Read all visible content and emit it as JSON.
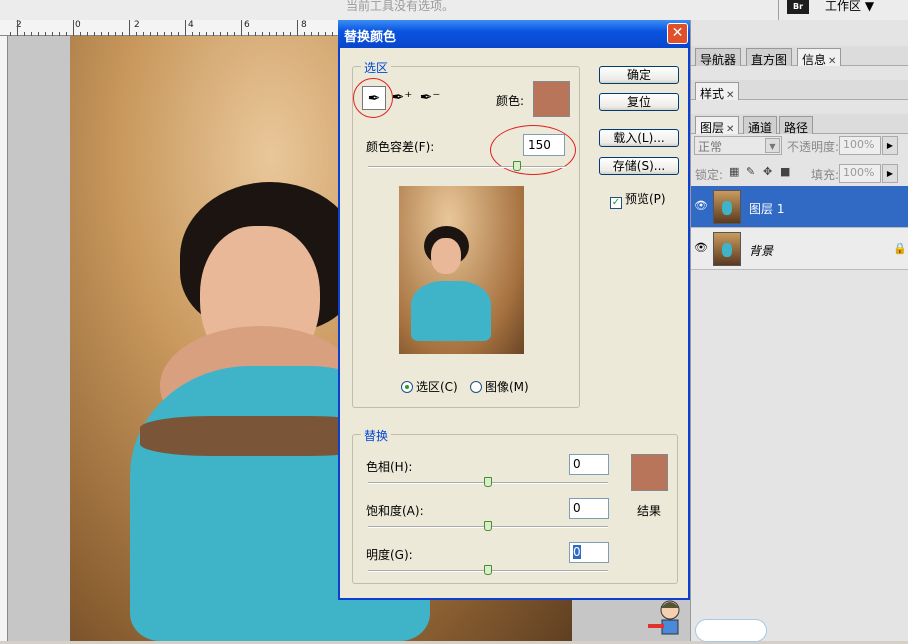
{
  "options_bar": {
    "text": "当前工具没有选项。",
    "workspace": "工作区",
    "br_label": "Br"
  },
  "ruler": {
    "labels": [
      "2",
      "0",
      "2",
      "4",
      "6",
      "8"
    ]
  },
  "panels": {
    "row1_tabs": [
      "导航器",
      "直方图",
      "信息"
    ],
    "row2_tabs": [
      "样式"
    ],
    "row3_tabs": [
      "图层",
      "通道",
      "路径"
    ],
    "blend_mode": "正常",
    "opacity_label": "不透明度:",
    "opacity_value": "100%",
    "lock_label": "锁定:",
    "fill_label": "填充:",
    "fill_value": "100%",
    "layers": [
      {
        "name": "图层 1",
        "selected": true
      },
      {
        "name": "背景",
        "locked": true
      }
    ]
  },
  "dialog": {
    "title": "替换颜色",
    "selection_group": "选区",
    "color_label": "颜色:",
    "selected_color": "#b87559",
    "fuzziness_label": "颜色容差(F):",
    "fuzziness_value": "150",
    "fuzziness_fraction": 0.75,
    "buttons": {
      "ok": "确定",
      "reset": "复位",
      "load": "载入(L)...",
      "save": "存储(S)..."
    },
    "preview_label": "预览(P)",
    "preview_checked": true,
    "radio_selection": "选区(C)",
    "radio_image": "图像(M)",
    "radio_selected": "selection",
    "replace_group": "替换",
    "hue_label": "色相(H):",
    "hue_value": "0",
    "saturation_label": "饱和度(A):",
    "saturation_value": "0",
    "lightness_label": "明度(G):",
    "lightness_value": "0",
    "result_label": "结果",
    "result_color": "#b87559"
  },
  "colors": {
    "accent": "#0a54e0",
    "layer_selected": "#316ac5",
    "annotation": "#e02020"
  }
}
